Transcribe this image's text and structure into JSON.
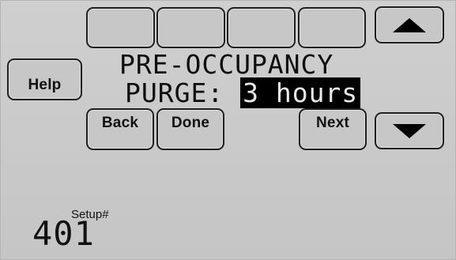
{
  "buttons": {
    "help": "Help",
    "back": "Back",
    "done": "Done",
    "next": "Next",
    "up_icon": "triangle-up",
    "down_icon": "triangle-down"
  },
  "screen": {
    "title_line1": "PRE-OCCUPANCY",
    "title_line2_prefix": "PURGE:",
    "value": "3 hours"
  },
  "setup": {
    "label": "Setup#",
    "number": "401"
  },
  "colors": {
    "background": "#c9c9c9",
    "value_highlight": "#000000"
  }
}
